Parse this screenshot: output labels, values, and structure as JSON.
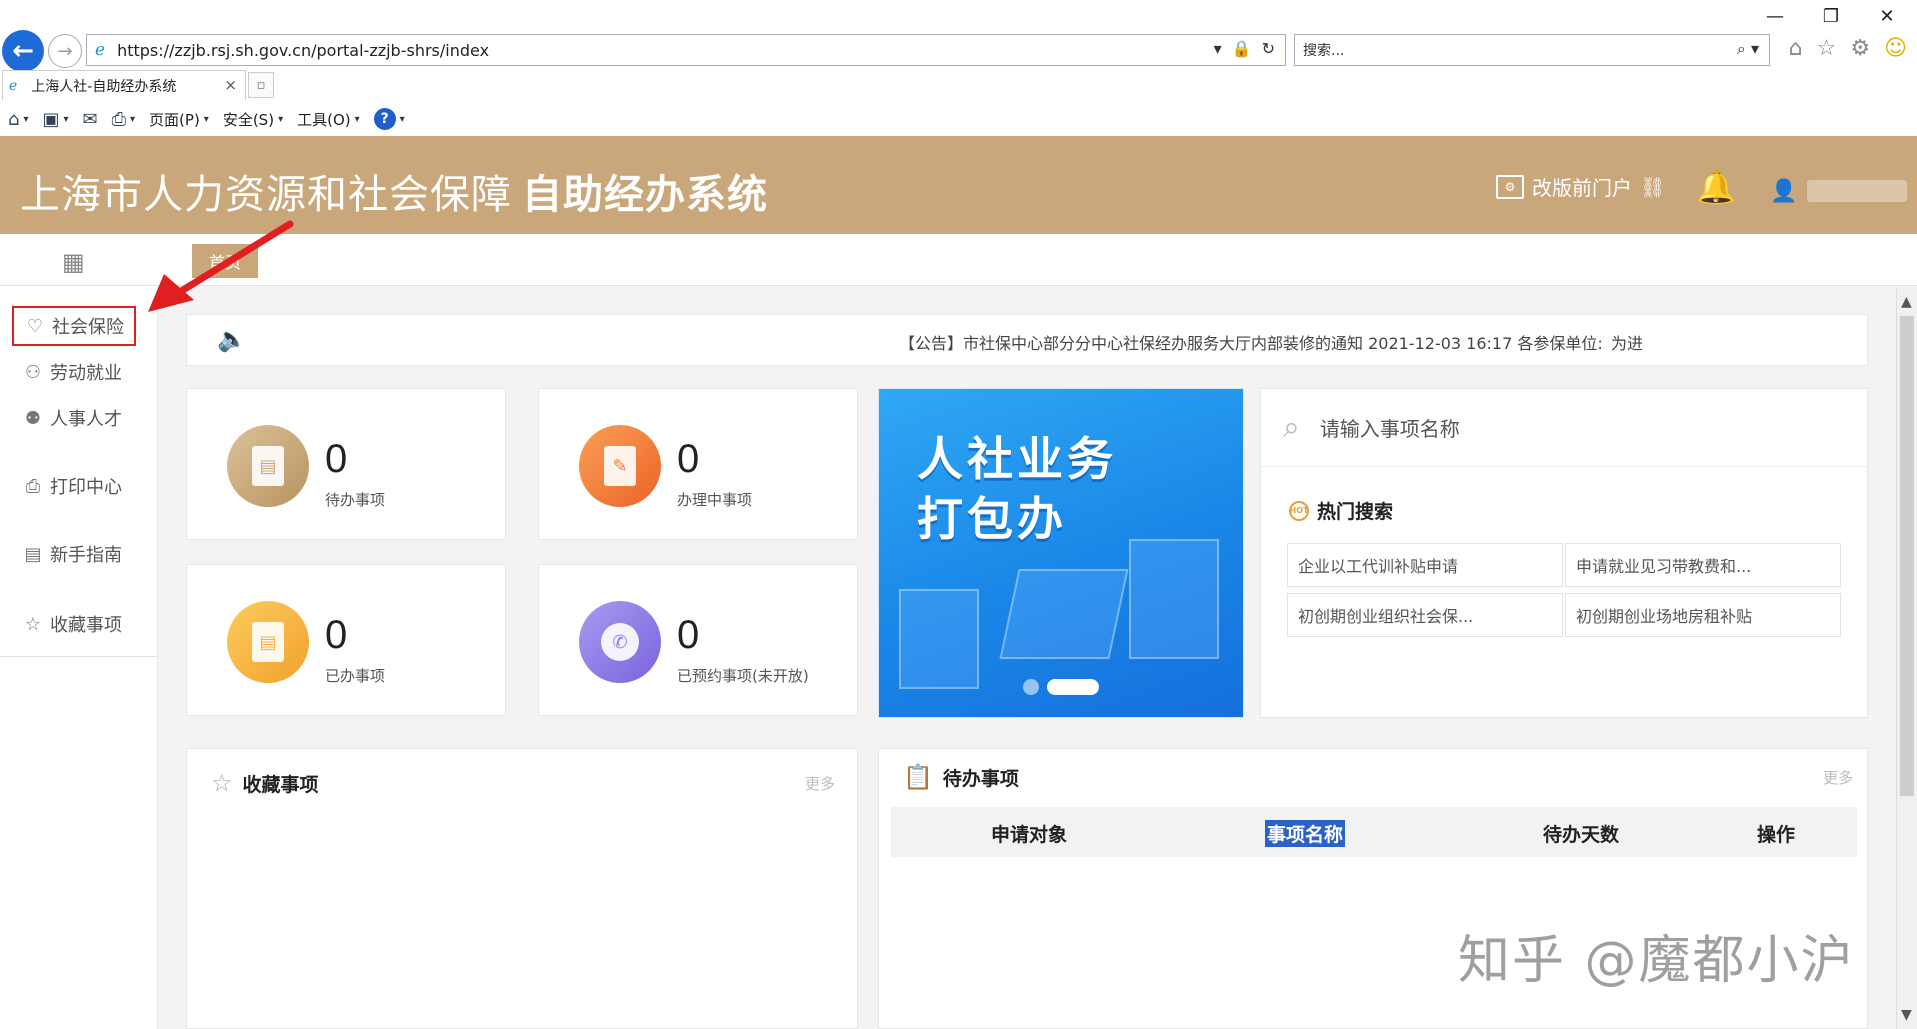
{
  "browser": {
    "url": "https://zzjb.rsj.sh.gov.cn/portal-zzjb-shrs/index",
    "search_placeholder": "搜索...",
    "tab_title": "上海人社-自助经办系统",
    "commands": [
      "页面(P)",
      "安全(S)",
      "工具(O)"
    ],
    "help_glyph": "?"
  },
  "header": {
    "title_light": "上海市人力资源和社会保障",
    "title_bold": "自助经办系统",
    "portal_link": "改版前门户"
  },
  "subbar": {
    "home_tab": "首页"
  },
  "sidebar": {
    "items": [
      {
        "label": "社会保险",
        "icon": "hands-heart-icon"
      },
      {
        "label": "劳动就业",
        "icon": "worker-icon"
      },
      {
        "label": "人事人才",
        "icon": "people-icon"
      },
      {
        "label": "打印中心",
        "icon": "printer-icon"
      },
      {
        "label": "新手指南",
        "icon": "guide-icon"
      },
      {
        "label": "收藏事项",
        "icon": "star-icon"
      }
    ]
  },
  "announcement": {
    "text": "【公告】市社保中心部分分中心社保经办服务大厅内部装修的通知 2021-12-03 16:17 各参保单位:",
    "tail": "为进"
  },
  "stats": [
    {
      "count": "0",
      "label": "待办事项",
      "color": "#c9a77a"
    },
    {
      "count": "0",
      "label": "办理中事项",
      "color": "#f07a3a"
    },
    {
      "count": "0",
      "label": "已办事项",
      "color": "#f5b13f"
    },
    {
      "count": "0",
      "label": "已预约事项(未开放)",
      "color": "#8b78e6"
    }
  ],
  "banner": {
    "line1": "人社业务",
    "line2": "打包办"
  },
  "search": {
    "placeholder": "请输入事项名称",
    "hot_title": "热门搜索",
    "hot_badge": "HOT",
    "hot_items": [
      "企业以工代训补贴申请",
      "申请就业见习带教费和...",
      "初创期创业组织社会保...",
      "初创期创业场地房租补贴"
    ]
  },
  "favorites": {
    "title": "收藏事项",
    "more": "更多"
  },
  "todo": {
    "title": "待办事项",
    "more": "更多",
    "columns": [
      "申请对象",
      "事项名称",
      "待办天数",
      "操作"
    ]
  },
  "watermark": "知乎 @魔都小沪"
}
